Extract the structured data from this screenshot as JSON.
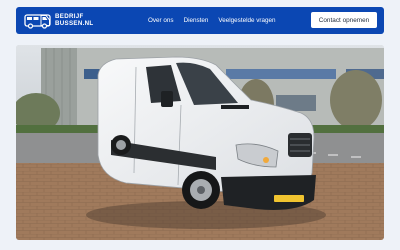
{
  "brand": {
    "line1": "BEDRIJF",
    "line2": "BUSSEN.NL",
    "logo_icon": "van-icon"
  },
  "nav": {
    "items": [
      {
        "label": "Over ons"
      },
      {
        "label": "Diensten"
      },
      {
        "label": "Veelgestelde vragen"
      }
    ],
    "cta_label": "Contact opnemen"
  },
  "hero": {
    "image": "white-cargo-van-photo"
  },
  "colors": {
    "header_bg": "#0b47b3",
    "page_bg": "#eef2f8",
    "cta_bg": "#ffffff"
  }
}
